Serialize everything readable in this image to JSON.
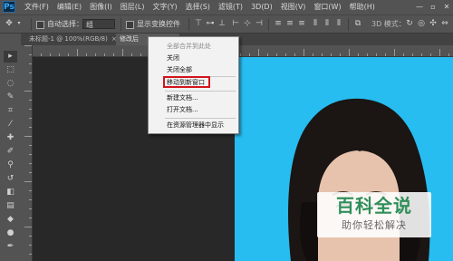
{
  "app": {
    "logo": "Ps"
  },
  "menubar": {
    "items": [
      "文件(F)",
      "编辑(E)",
      "图像(I)",
      "图层(L)",
      "文字(Y)",
      "选择(S)",
      "滤镜(T)",
      "3D(D)",
      "视图(V)",
      "窗口(W)",
      "帮助(H)"
    ],
    "window_controls": [
      "minimize-icon",
      "maximize-icon",
      "close-icon"
    ]
  },
  "options_bar": {
    "auto_select_label": "自动选择：",
    "auto_select_value": "组",
    "show_transform_label": "显示变换控件",
    "mode_3d_label": "3D 模式："
  },
  "tabs": [
    {
      "label": "未标题-1 @ 100%(RGB/8)",
      "close": "×"
    },
    {
      "label": "修改后"
    }
  ],
  "context_menu": {
    "items": [
      {
        "label": "全部合并到此处",
        "disabled": true
      },
      {
        "label": "关闭"
      },
      {
        "label": "关闭全部"
      },
      {
        "label": "移动到新窗口",
        "highlighted": true
      },
      {
        "label": "新建文档..."
      },
      {
        "label": "打开文档..."
      },
      {
        "label": "在资源管理器中显示"
      }
    ]
  },
  "watermark": {
    "title": "百科全说",
    "subtitle": "助你轻松解决"
  },
  "colors": {
    "photo_bg": "#27bdf0",
    "highlight": "#d4141c",
    "watermark_green": "#2f8f5a"
  }
}
